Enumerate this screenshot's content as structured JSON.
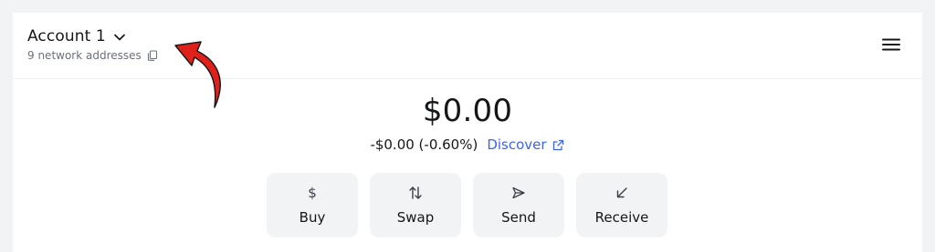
{
  "header": {
    "account_name": "Account 1",
    "network_addresses": "9 network addresses"
  },
  "balance": {
    "total": "$0.00",
    "change": "-$0.00 (-0.60%)",
    "discover_label": "Discover"
  },
  "actions": [
    {
      "label": "Buy",
      "icon": "dollar-icon"
    },
    {
      "label": "Swap",
      "icon": "swap-arrows-icon"
    },
    {
      "label": "Send",
      "icon": "send-arrow-icon"
    },
    {
      "label": "Receive",
      "icon": "receive-arrow-icon"
    }
  ],
  "colors": {
    "link": "#3d65ea",
    "annotation": "#e0201b",
    "action_bg": "#f2f3f5"
  }
}
